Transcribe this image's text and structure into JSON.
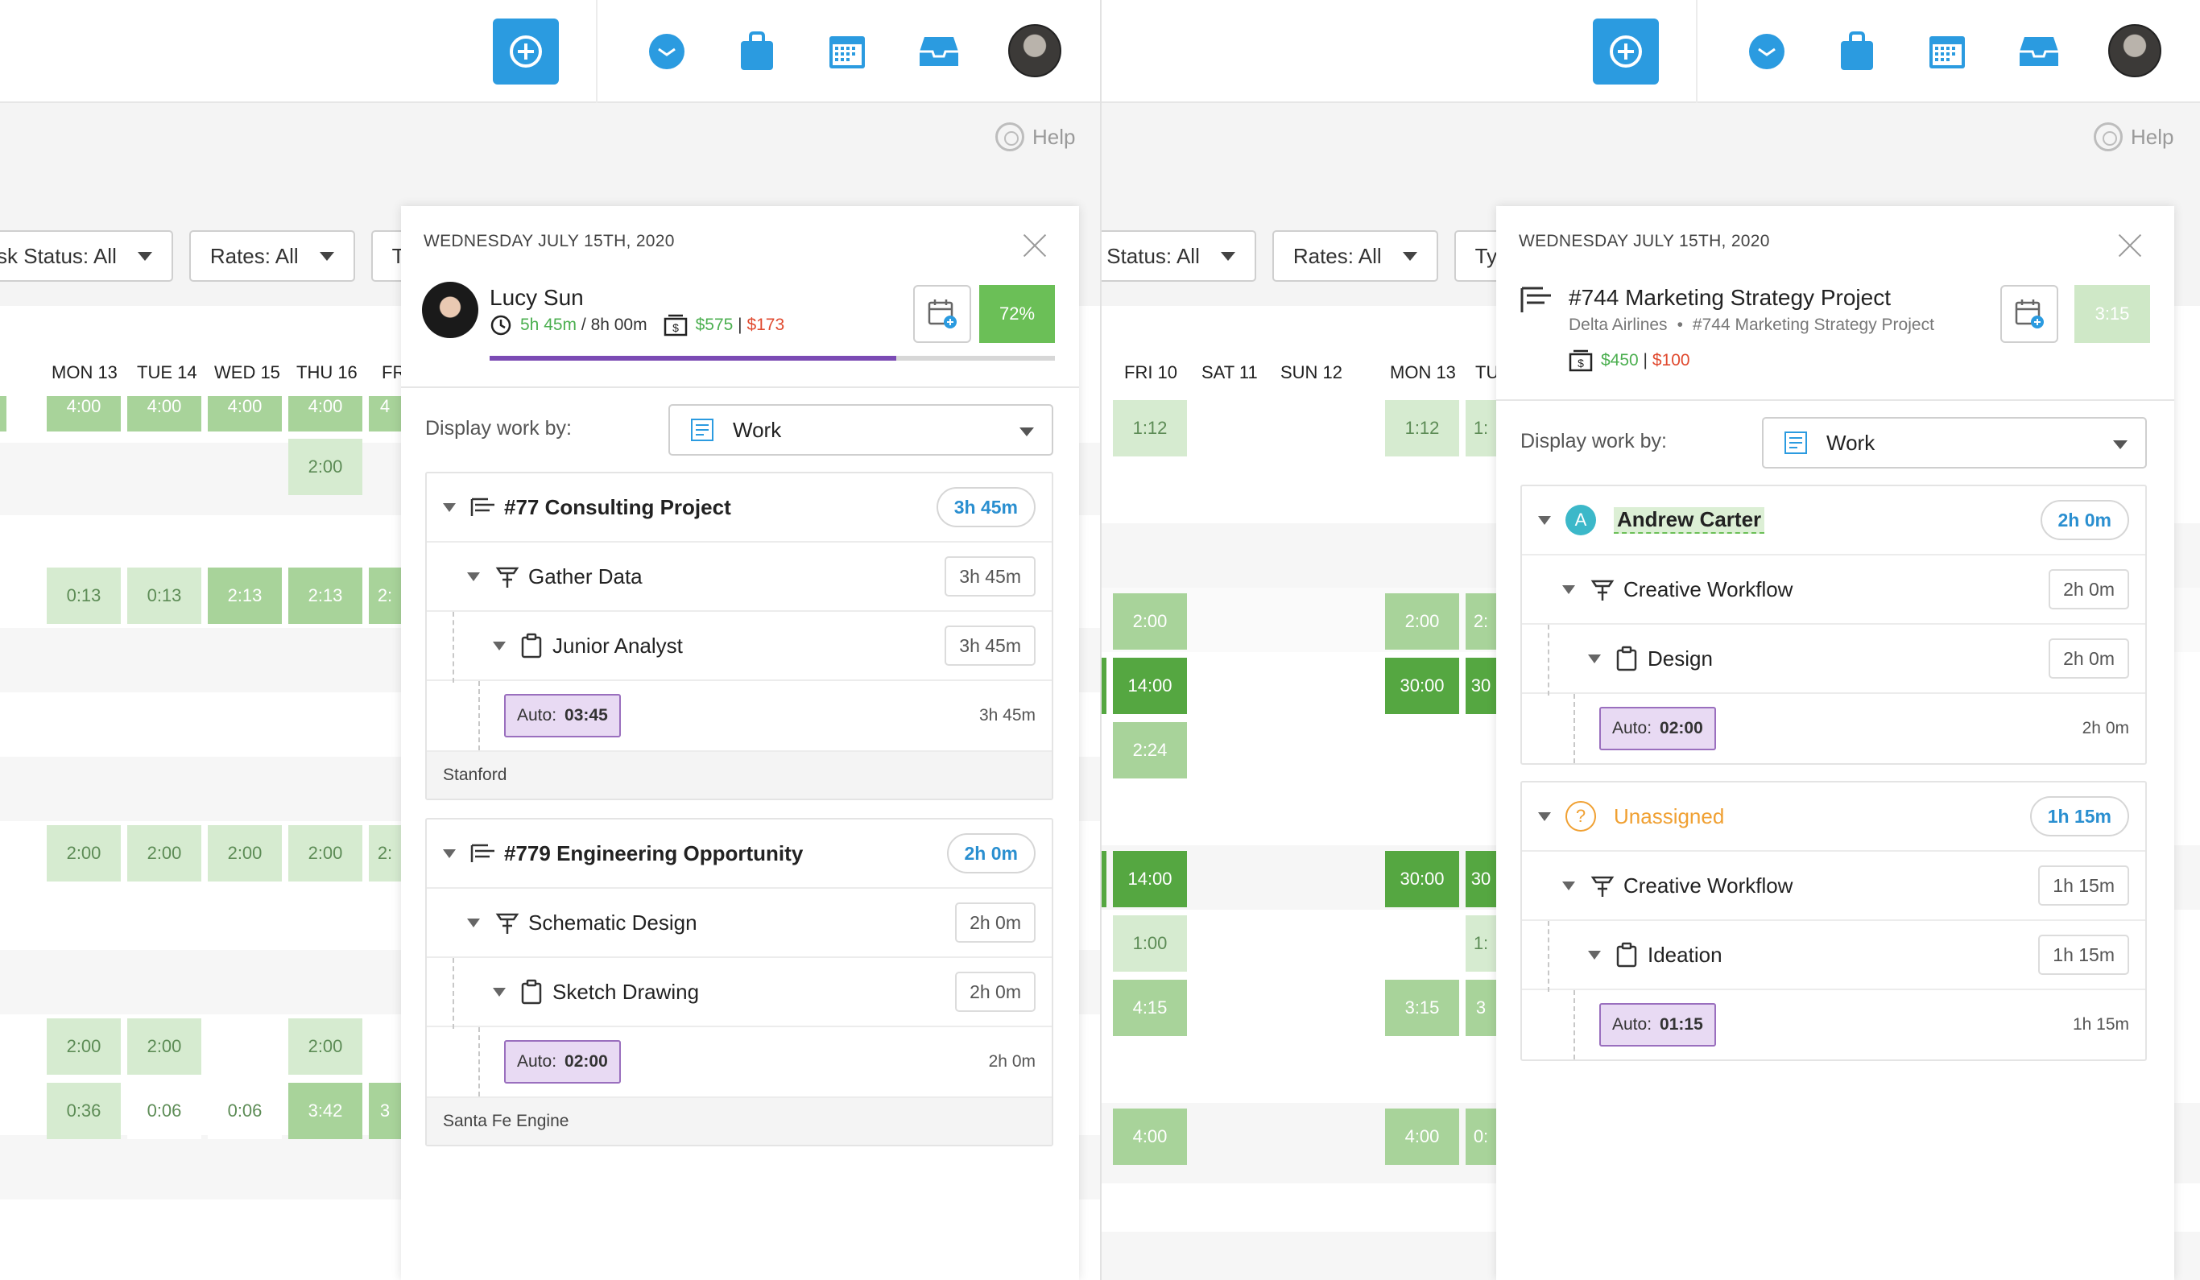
{
  "left": {
    "help": "Help",
    "filters": [
      "sk Status: All",
      "Rates: All",
      "Type:"
    ],
    "days": [
      "MON 13",
      "TUE 14",
      "WED 15",
      "THU 16",
      "FR"
    ],
    "cells": [
      [
        "4:00",
        "4:00",
        "4:00",
        "4:00",
        "4"
      ],
      [
        "",
        "",
        "",
        "2:00",
        ""
      ],
      [
        "0:13",
        "0:13",
        "2:13",
        "2:13",
        "2:"
      ],
      [
        "2:00",
        "2:00",
        "2:00",
        "2:00",
        "2:"
      ],
      [
        "2:00",
        "2:00",
        "",
        "2:00",
        ""
      ],
      [
        "0:36",
        "0:06",
        "0:06",
        "3:42",
        "3"
      ]
    ],
    "panel": {
      "date": "WEDNESDAY JULY 15TH, 2020",
      "user_name": "Lucy Sun",
      "time_done": "5h 45m",
      "time_sep": " / ",
      "time_total": "8h 00m",
      "rate_green": "$575",
      "rate_sep": " | ",
      "rate_red": "$173",
      "progress": 0.72,
      "percent_label": "72%",
      "display_by_label": "Display work by:",
      "display_by_value": "Work",
      "groups": [
        {
          "project": "#77 Consulting Project",
          "project_total": "3h 45m",
          "task": "Gather Data",
          "task_total": "3h 45m",
          "role": "Junior Analyst",
          "role_total": "3h 45m",
          "auto_label": "Auto:",
          "auto_value": "03:45",
          "auto_dur": "3h 45m",
          "footer": "Stanford"
        },
        {
          "project": "#779 Engineering Opportunity",
          "project_total": "2h 0m",
          "task": "Schematic Design",
          "task_total": "2h 0m",
          "role": "Sketch Drawing",
          "role_total": "2h 0m",
          "auto_label": "Auto:",
          "auto_value": "02:00",
          "auto_dur": "2h 0m",
          "footer": "Santa Fe Engine"
        }
      ]
    }
  },
  "right": {
    "help": "Help",
    "filters": [
      "k Status: All",
      "Rates: All",
      "Type:"
    ],
    "days": [
      "FRI 10",
      "SAT 11",
      "SUN 12",
      "MON 13",
      "TU"
    ],
    "cells": [
      [
        "1:12",
        "",
        "",
        "1:12",
        "1:"
      ],
      [
        "2:00",
        "",
        "",
        "2:00",
        "2:"
      ],
      [
        "14:00",
        "",
        "",
        "30:00",
        "30"
      ],
      [
        "2:24",
        "",
        "",
        "",
        ""
      ],
      [
        "14:00",
        "",
        "",
        "30:00",
        "30"
      ],
      [
        "1:00",
        "",
        "",
        "",
        "1:"
      ],
      [
        "4:15",
        "",
        "",
        "3:15",
        "3"
      ],
      [
        "4:00",
        "",
        "",
        "4:00",
        "0:"
      ]
    ],
    "panel": {
      "date": "WEDNESDAY JULY 15TH, 2020",
      "project_title": "#744 Marketing Strategy Project",
      "client": "Delta Airlines",
      "dot": "•",
      "project_sub": "#744 Marketing Strategy Project",
      "rate_green": "$450",
      "rate_sep": " | ",
      "rate_red": "$100",
      "time_label": "3:15",
      "display_by_label": "Display work by:",
      "display_by_value": "Work",
      "groups": [
        {
          "person_initial": "A",
          "person": "Andrew Carter",
          "person_total": "2h 0m",
          "task": "Creative Workflow",
          "task_total": "2h 0m",
          "role": "Design",
          "role_total": "2h 0m",
          "auto_label": "Auto:",
          "auto_value": "02:00",
          "auto_dur": "2h 0m"
        },
        {
          "person_initial": "?",
          "person": "Unassigned",
          "person_total": "1h 15m",
          "task": "Creative Workflow",
          "task_total": "1h 15m",
          "role": "Ideation",
          "role_total": "1h 15m",
          "auto_label": "Auto:",
          "auto_value": "01:15",
          "auto_dur": "1h 15m"
        }
      ]
    }
  },
  "colors": {
    "accent_blue": "#2b9be0",
    "purple_progress": "#7b4bb4",
    "green_dark": "#55a741",
    "green_mid": "#a8d39a",
    "green_light": "#d6ebd0",
    "rate_green": "#4caf50",
    "rate_red": "#e04a2f",
    "unassigned_orange": "#f0a032"
  },
  "icons": [
    "add-icon",
    "inbox-icon",
    "bag-icon",
    "calendar-icon",
    "tray-icon",
    "avatar",
    "help-icon",
    "close-icon",
    "schedule-icon",
    "clock-icon",
    "money-icon",
    "work-list-icon",
    "project-icon",
    "task-icon",
    "clipboard-icon",
    "person-initial-icon",
    "question-icon"
  ]
}
